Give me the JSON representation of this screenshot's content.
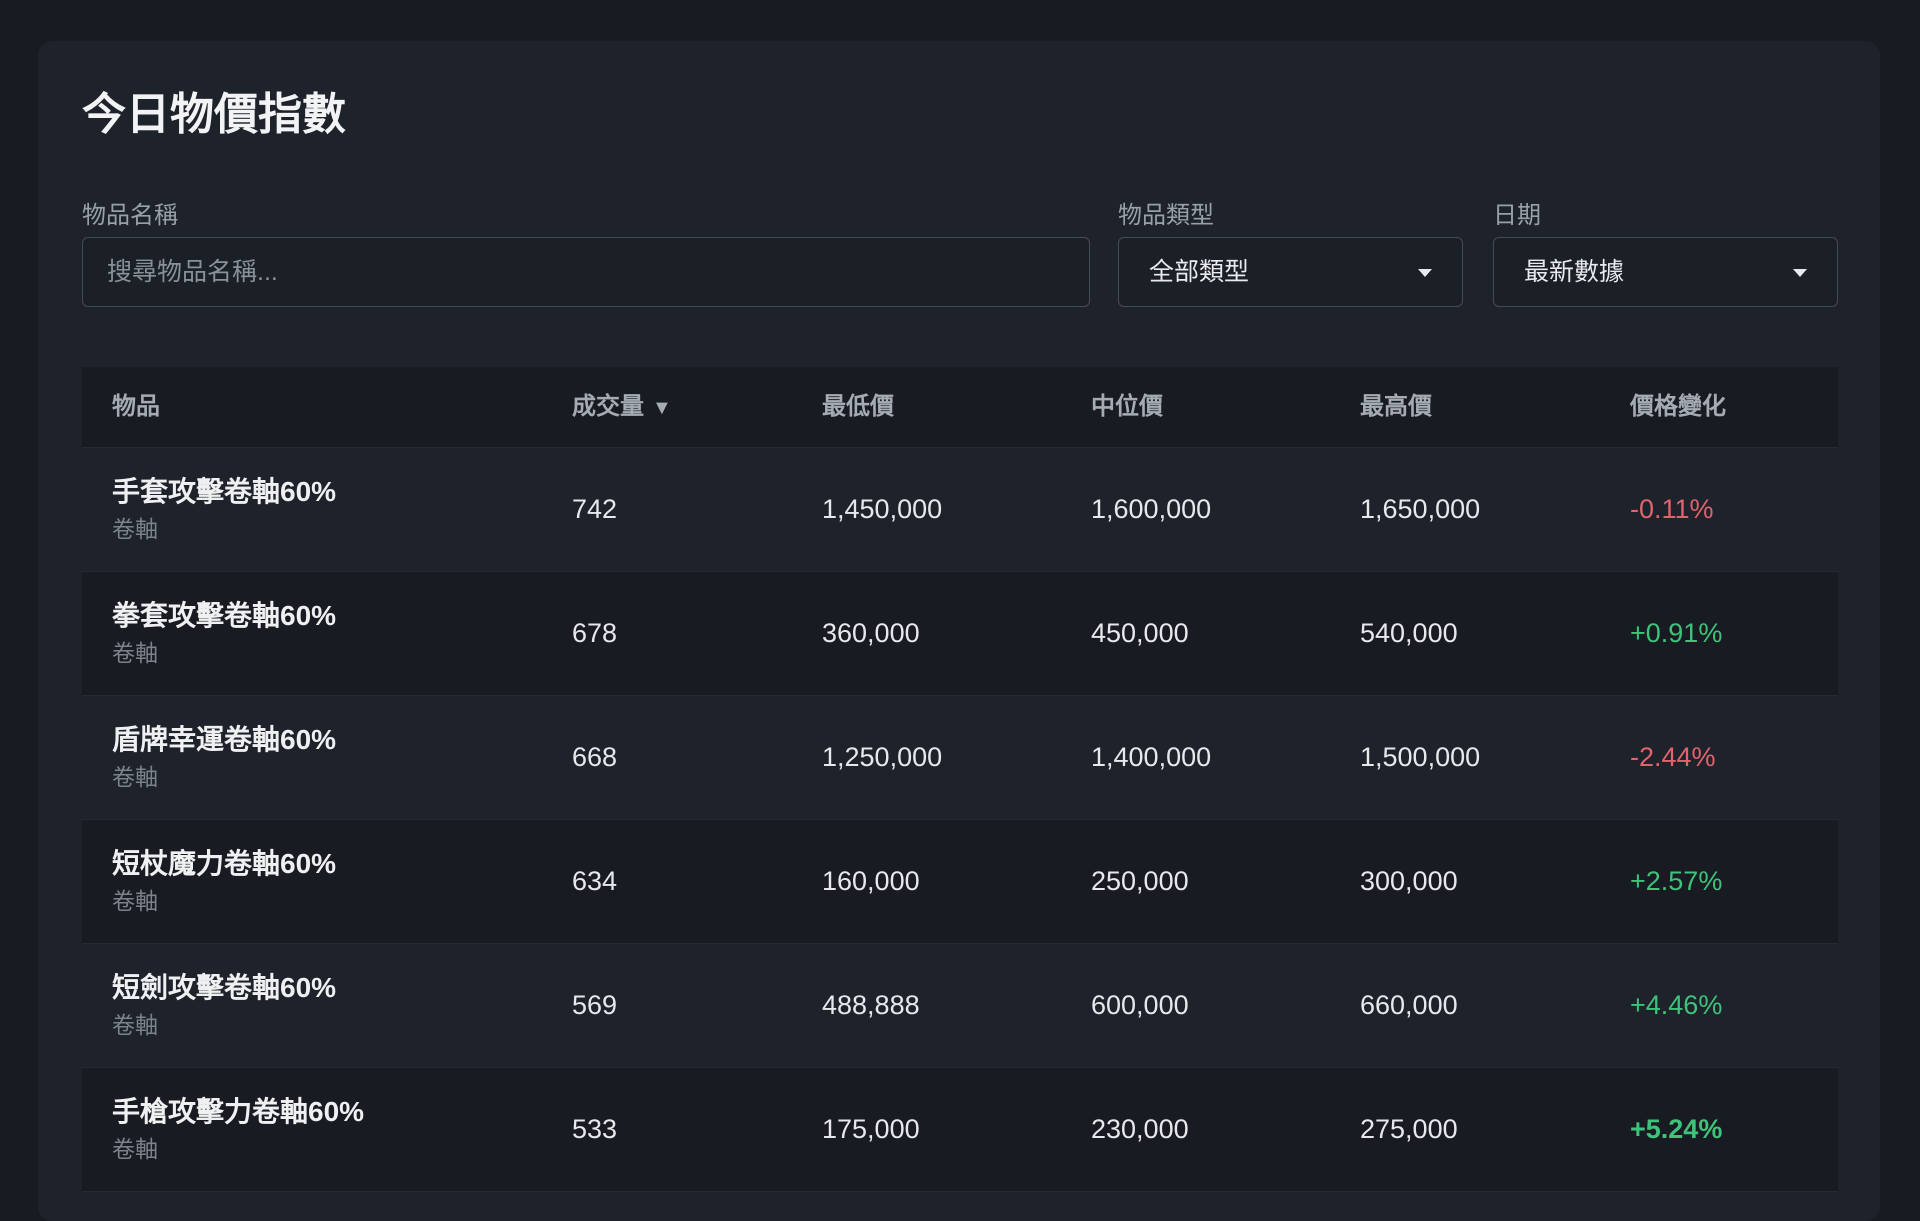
{
  "page": {
    "title": "今日物價指數"
  },
  "filters": {
    "name_label": "物品名稱",
    "name_placeholder": "搜尋物品名稱...",
    "name_value": "",
    "type_label": "物品類型",
    "type_value": "全部類型",
    "date_label": "日期",
    "date_value": "最新數據"
  },
  "table": {
    "headers": {
      "item": "物品",
      "volume": "成交量",
      "volume_sort_icon": "▼",
      "min": "最低價",
      "median": "中位價",
      "max": "最高價",
      "change": "價格變化"
    },
    "rows": [
      {
        "name": "手套攻擊卷軸60%",
        "category": "卷軸",
        "volume": "742",
        "min": "1,450,000",
        "median": "1,600,000",
        "max": "1,650,000",
        "change": "-0.11%",
        "direction": "down"
      },
      {
        "name": "拳套攻擊卷軸60%",
        "category": "卷軸",
        "volume": "678",
        "min": "360,000",
        "median": "450,000",
        "max": "540,000",
        "change": "+0.91%",
        "direction": "up"
      },
      {
        "name": "盾牌幸運卷軸60%",
        "category": "卷軸",
        "volume": "668",
        "min": "1,250,000",
        "median": "1,400,000",
        "max": "1,500,000",
        "change": "-2.44%",
        "direction": "down"
      },
      {
        "name": "短杖魔力卷軸60%",
        "category": "卷軸",
        "volume": "634",
        "min": "160,000",
        "median": "250,000",
        "max": "300,000",
        "change": "+2.57%",
        "direction": "up"
      },
      {
        "name": "短劍攻擊卷軸60%",
        "category": "卷軸",
        "volume": "569",
        "min": "488,888",
        "median": "600,000",
        "max": "660,000",
        "change": "+4.46%",
        "direction": "up"
      },
      {
        "name": "手槍攻擊力卷軸60%",
        "category": "卷軸",
        "volume": "533",
        "min": "175,000",
        "median": "230,000",
        "max": "275,000",
        "change": "+5.24%",
        "direction": "up",
        "emphasis": true
      }
    ]
  },
  "colors": {
    "negative": "#e0636d",
    "positive": "#3fc279",
    "background": "#181b22",
    "card": "#1e222a"
  },
  "icons": {
    "dropdown": "caret-down-icon",
    "sort": "sort-desc-icon"
  }
}
